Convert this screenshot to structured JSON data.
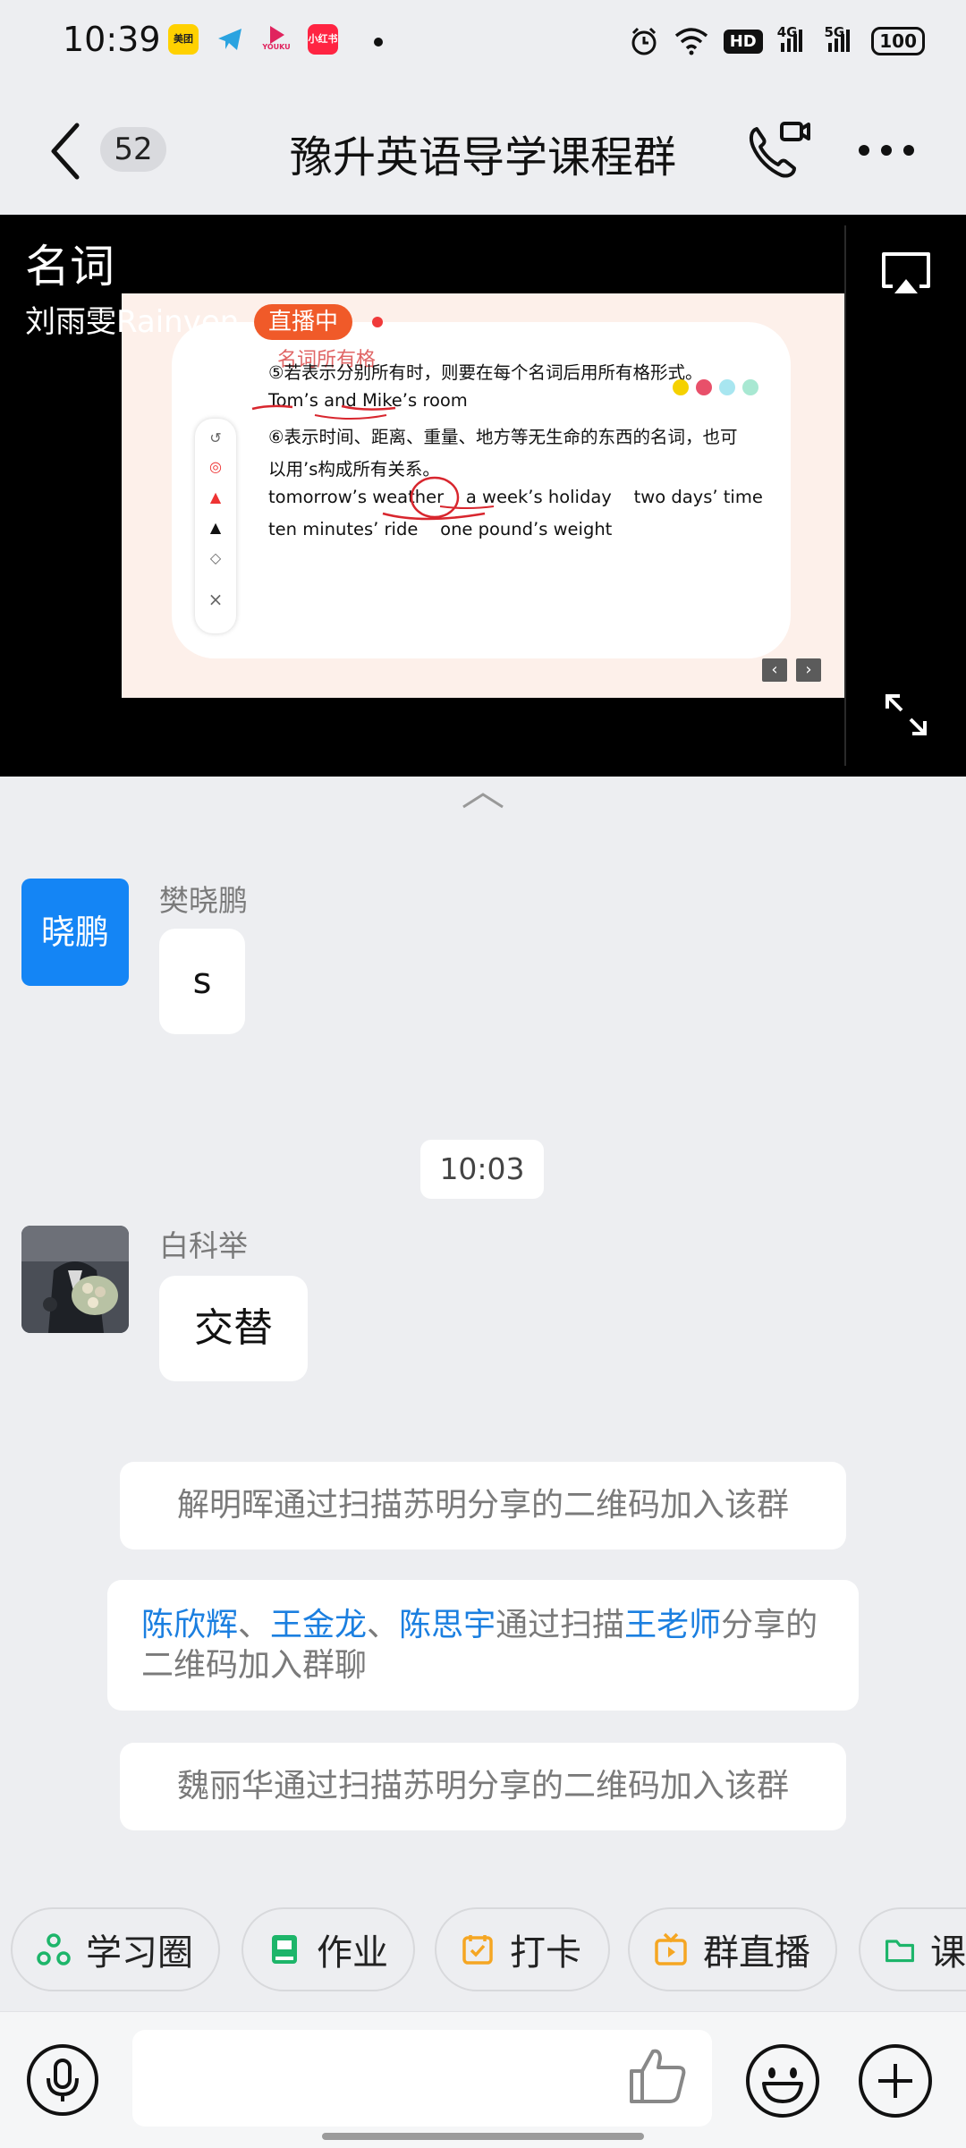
{
  "status_bar": {
    "time": "10:39",
    "apps": [
      "美团",
      "Telegram",
      "YOUKU",
      "小红书"
    ],
    "network_4g": "4G",
    "network_5g": "5G",
    "hd": "HD",
    "battery": "100"
  },
  "header": {
    "unread_count": "52",
    "title": "豫升英语导学课程群"
  },
  "live": {
    "title": "名词",
    "teacher": "刘雨雯Rainven",
    "status": "直播中",
    "slide": {
      "subtitle": "名词所有格",
      "lines": [
        "⑤若表示分别所有时，则要在每个名词后用所有格形式。",
        "Tom’s and Mike’s room",
        "⑥表示时间、距离、重量、地方等无生命的东西的名词，也可",
        "以用’s构成所有关系。",
        "tomorrow’s weather    a week’s holiday    two days’ time",
        "ten minutes’ ride    one pound’s weight"
      ],
      "prev": "‹",
      "next": "›"
    }
  },
  "messages": [
    {
      "sender": "樊晓鹏",
      "avatar_text": "晓鹏",
      "text": "s"
    },
    {
      "time": "10:03"
    },
    {
      "sender": "白科举",
      "text": "交替"
    }
  ],
  "system_notices": {
    "n1": "解明晖通过扫描苏明分享的二维码加入该群",
    "n2_user1": "陈欣辉",
    "n2_sep1": "、",
    "n2_user2": "王金龙",
    "n2_sep2": "、",
    "n2_user3": "陈思宇",
    "n2_mid": "通过扫描",
    "n2_sharer": "王老师",
    "n2_end": "分享的二维码加入群聊",
    "n3": "魏丽华通过扫描苏明分享的二维码加入该群"
  },
  "quick_actions": [
    "学习圈",
    "作业",
    "打卡",
    "群直播",
    "课"
  ],
  "colors": {
    "accent_blue": "#1485F5",
    "link_blue": "#1B7FE0",
    "live_orange": "#F05A29",
    "background": "#EDEEF1"
  },
  "icons": [
    "back-icon",
    "call-video-icon",
    "more-icon",
    "airplay-icon",
    "expand-icon",
    "collapse-icon",
    "mic-icon",
    "thumbs-up-icon",
    "emoji-icon",
    "plus-icon"
  ]
}
